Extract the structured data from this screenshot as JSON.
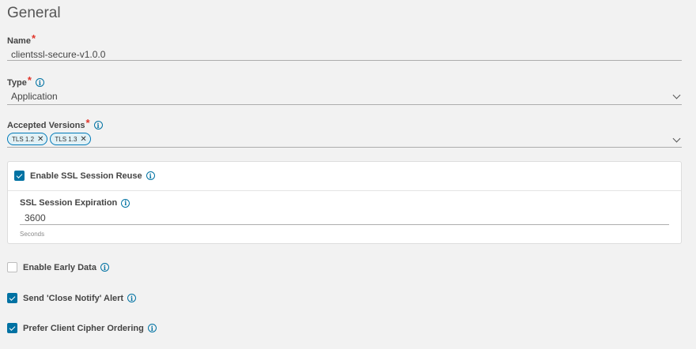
{
  "section": {
    "title": "General"
  },
  "name_field": {
    "label": "Name",
    "required": "*",
    "value": "clientssl-secure-v1.0.0"
  },
  "type_field": {
    "label": "Type",
    "required": "*",
    "value": "Application"
  },
  "versions_field": {
    "label": "Accepted Versions",
    "required": "*",
    "chips": [
      "TLS 1.2",
      "TLS 1.3"
    ]
  },
  "session_reuse": {
    "label": "Enable SSL Session Reuse",
    "checked": true,
    "expiration_label": "SSL Session Expiration",
    "expiration_value": "3600",
    "expiration_unit": "Seconds"
  },
  "early_data": {
    "label": "Enable Early Data",
    "checked": false
  },
  "close_notify": {
    "label": "Send 'Close Notify' Alert",
    "checked": true
  },
  "cipher_order": {
    "label": "Prefer Client Cipher Ordering",
    "checked": true
  },
  "colors": {
    "accent": "#0072a3",
    "required": "#e0352b",
    "chip_bg": "#e1f1f6"
  },
  "icons": {
    "info": "info-circle-icon",
    "dropdown": "chevron-down-icon",
    "remove": "close-icon"
  }
}
